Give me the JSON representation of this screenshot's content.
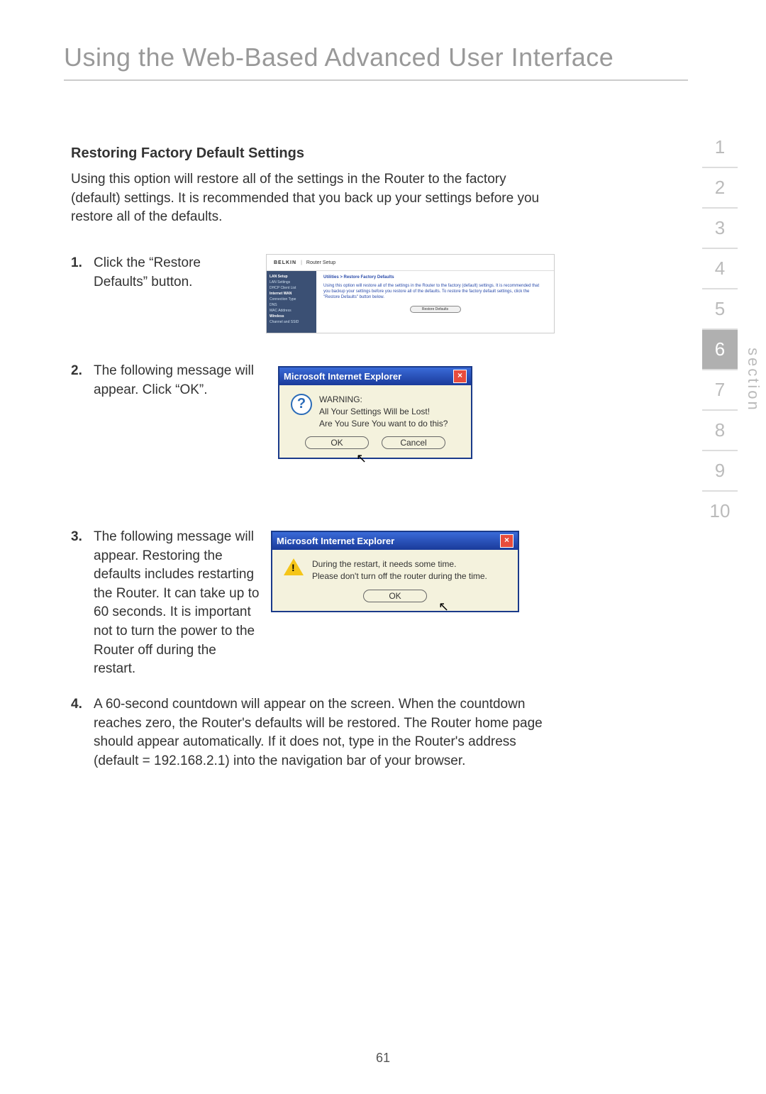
{
  "title": "Using the Web-Based Advanced User Interface",
  "subhead": "Restoring Factory Default Settings",
  "intro": "Using this option will restore all of the settings in the Router to the factory (default) settings. It is recommended that you back up your settings before you restore all of the defaults.",
  "steps": {
    "s1_num": "1.",
    "s1_text": "Click the “Restore Defaults” button.",
    "s2_num": "2.",
    "s2_text": "The following message will appear. Click “OK”.",
    "s3_num": "3.",
    "s3_text": "The following message will appear. Restoring the defaults includes restarting the Router. It can take up to 60 seconds. It is important not to turn the power to the Router off during the restart.",
    "s4_num": "4.",
    "s4_text": "A 60-second countdown will appear on the screen. When the countdown reaches zero, the Router's defaults will be restored. The Router home page should appear automatically. If it does not, type in the Router's address (default = 192.168.2.1) into the navigation bar of your browser."
  },
  "screenshot1": {
    "logo": "BELKIN",
    "router_setup": "Router Setup",
    "breadcrumb": "Utilities > Restore Factory Defaults",
    "desc": "Using this option will restore all of the settings in the Router to the factory (default) settings. It is recommended that you backup your settings before you restore all of the defaults. To restore the factory default settings, click the \"Restore Defaults\" button below.",
    "button": "Restore Defaults",
    "side_lan": "LAN Setup",
    "side_lan1": "LAN Settings",
    "side_lan2": "DHCP Client List",
    "side_wan": "Internet WAN",
    "side_wan1": "Connection Type",
    "side_wan2": "DNS",
    "side_wan3": "MAC Address",
    "side_wl": "Wireless",
    "side_wl1": "Channel and SSID"
  },
  "dialog1": {
    "title": "Microsoft Internet Explorer",
    "line1": "WARNING:",
    "line2": "All Your Settings Will be Lost!",
    "line3": "Are You Sure You want to do this?",
    "ok": "OK",
    "cancel": "Cancel"
  },
  "dialog2": {
    "title": "Microsoft Internet Explorer",
    "line1": "During the restart, it needs some time.",
    "line2": "Please don't turn off the router during the time.",
    "ok": "OK"
  },
  "nav": {
    "n1": "1",
    "n2": "2",
    "n3": "3",
    "n4": "4",
    "n5": "5",
    "n6": "6",
    "n7": "7",
    "n8": "8",
    "n9": "9",
    "n10": "10",
    "label": "section"
  },
  "pagenum": "61"
}
